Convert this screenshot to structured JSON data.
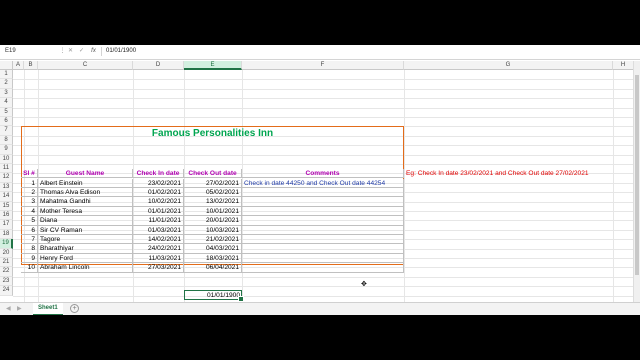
{
  "formula_bar": {
    "name_box": "E19",
    "cancel": "✕",
    "enter": "✓",
    "fx": "fx",
    "value": "01/01/1900"
  },
  "columns": [
    "A",
    "B",
    "C",
    "D",
    "E",
    "F",
    "G",
    "H"
  ],
  "rows": [
    "1",
    "2",
    "3",
    "4",
    "5",
    "6",
    "7",
    "8",
    "9",
    "10",
    "11",
    "12",
    "13",
    "14",
    "15",
    "16",
    "17",
    "18",
    "19",
    "20",
    "21",
    "22",
    "23",
    "24"
  ],
  "title": "Famous Personalities Inn",
  "headers": {
    "sl": "Sl #",
    "guest": "Guest Name",
    "checkin": "Check In date",
    "checkout": "Check Out date",
    "comments": "Comments"
  },
  "guests": [
    {
      "sl": "1",
      "name": "Albert Einstein",
      "in": "23/02/2021",
      "out": "27/02/2021",
      "comment": "Check in date 44250 and Check Out date 44254"
    },
    {
      "sl": "2",
      "name": "Thomas Alva Edison",
      "in": "01/02/2021",
      "out": "05/02/2021",
      "comment": ""
    },
    {
      "sl": "3",
      "name": "Mahatma Gandhi",
      "in": "10/02/2021",
      "out": "13/02/2021",
      "comment": ""
    },
    {
      "sl": "4",
      "name": "Mother Teresa",
      "in": "01/01/2021",
      "out": "10/01/2021",
      "comment": ""
    },
    {
      "sl": "5",
      "name": "Diana",
      "in": "11/01/2021",
      "out": "20/01/2021",
      "comment": ""
    },
    {
      "sl": "6",
      "name": "Sir CV Raman",
      "in": "01/03/2021",
      "out": "10/03/2021",
      "comment": ""
    },
    {
      "sl": "7",
      "name": "Tagore",
      "in": "14/02/2021",
      "out": "21/02/2021",
      "comment": ""
    },
    {
      "sl": "8",
      "name": "Bharathiyar",
      "in": "24/02/2021",
      "out": "04/03/2021",
      "comment": ""
    },
    {
      "sl": "9",
      "name": "Henry Ford",
      "in": "11/03/2021",
      "out": "18/03/2021",
      "comment": ""
    },
    {
      "sl": "10",
      "name": "Abraham Lincoln",
      "in": "27/03/2021",
      "out": "06/04/2021",
      "comment": ""
    }
  ],
  "note": "Eg: Check In date 23/02/2021 and Check Out date 27/02/2021",
  "e19_value": "01/01/1900",
  "sheet_tab": "Sheet1",
  "add_sheet": "+",
  "colors": {
    "title": "#00a550",
    "header": "#b000b0",
    "note": "#e00000",
    "comment": "#1f3aa6",
    "border": "#e36c1a",
    "accent": "#217346"
  }
}
